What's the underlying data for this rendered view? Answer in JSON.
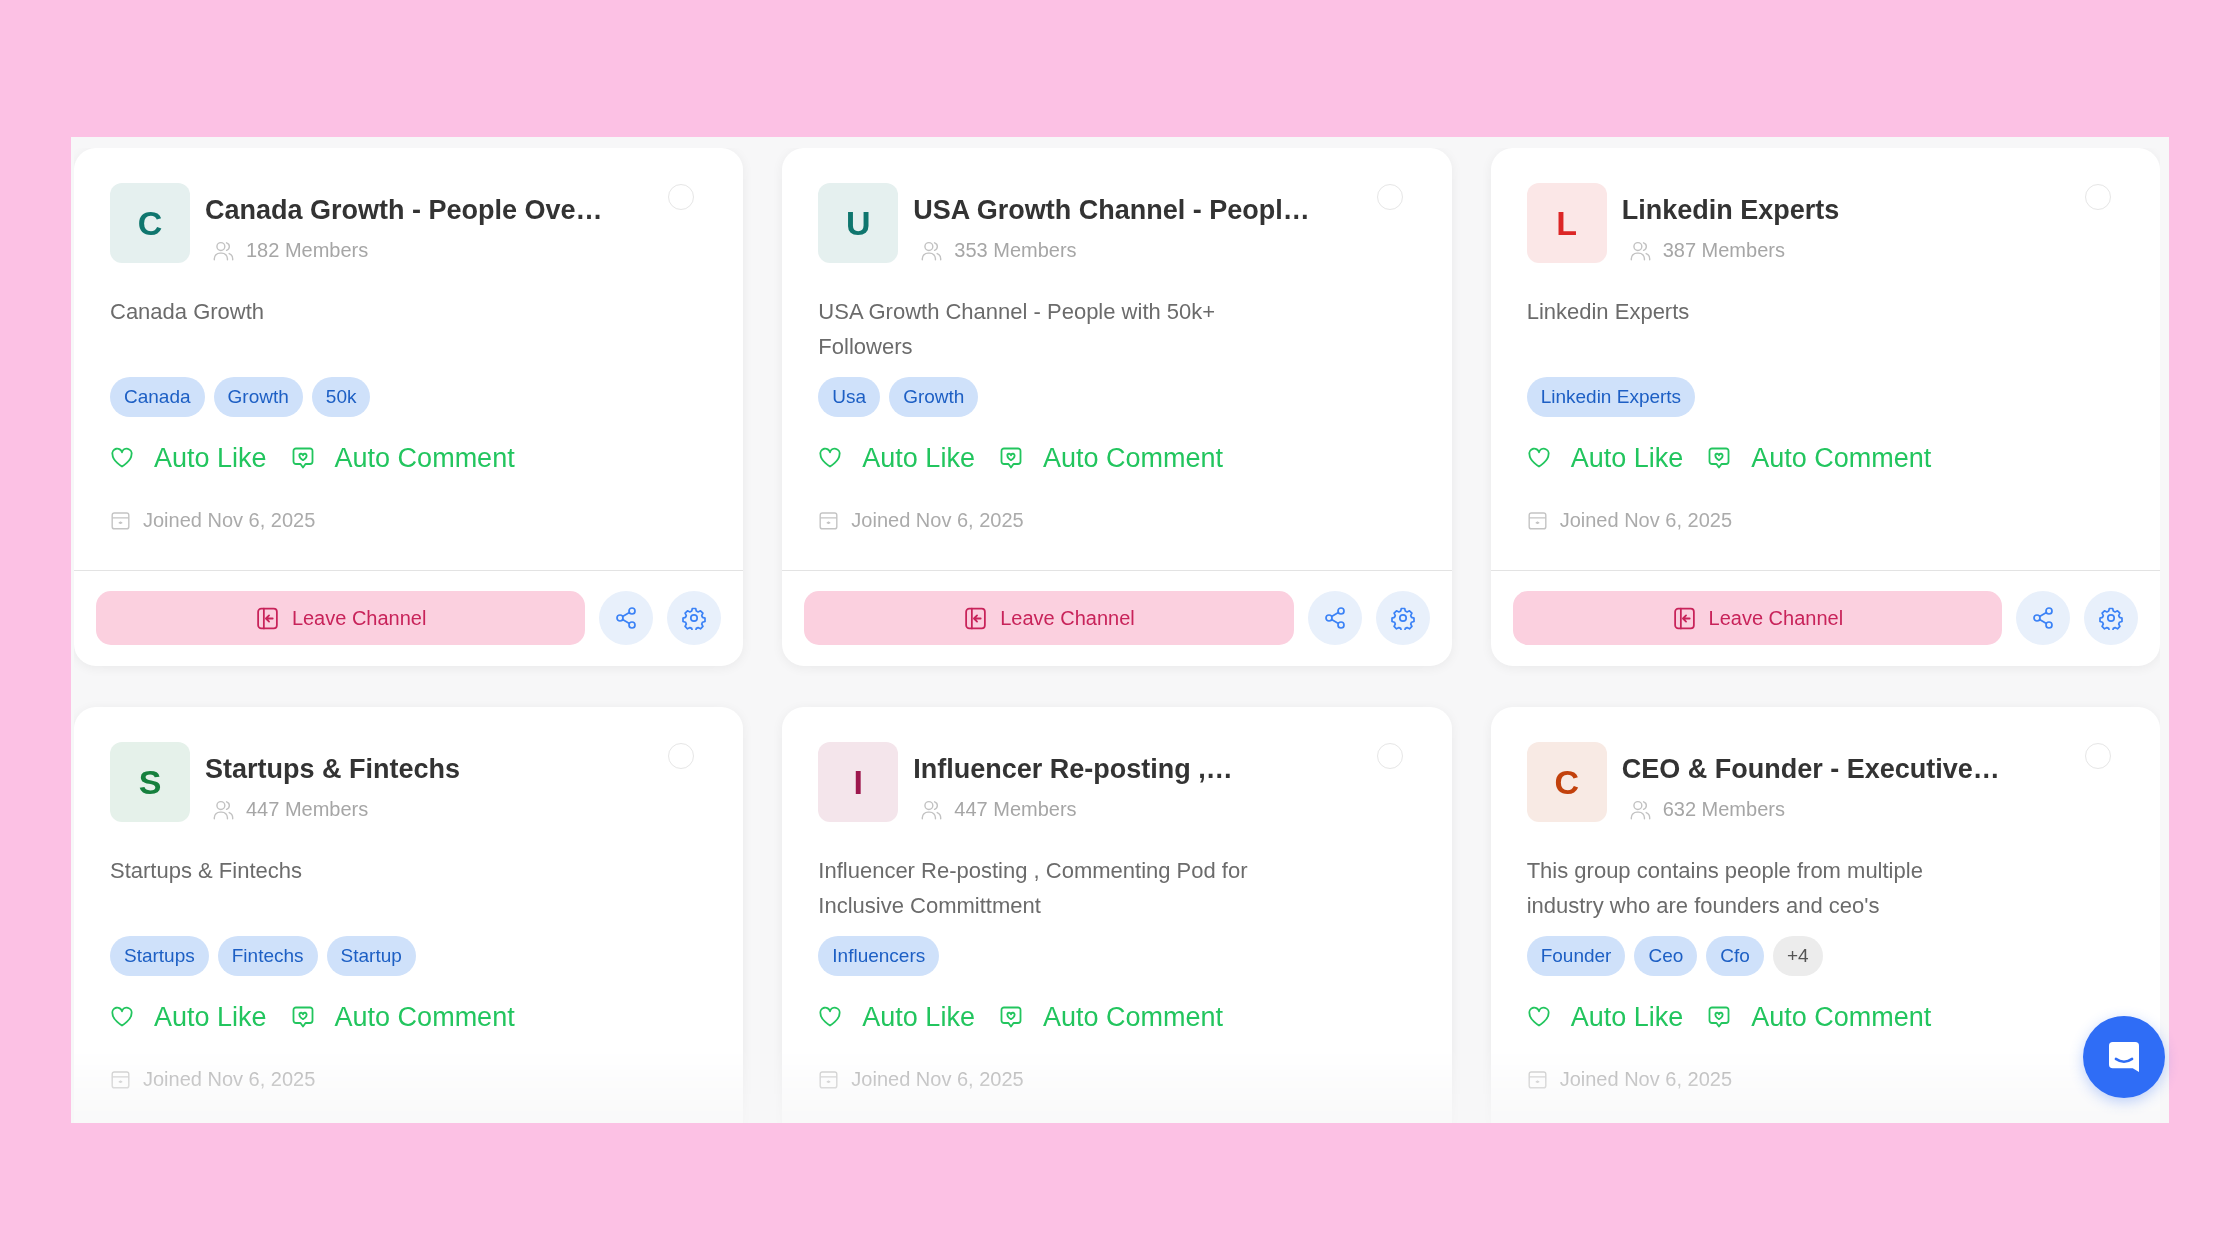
{
  "cards": [
    {
      "initial": "C",
      "color": "#0f766e",
      "title": "Canada Growth - People Ove…",
      "members": "182 Members",
      "checked": false,
      "description": "Canada Growth",
      "tags": [
        "Canada",
        "Growth",
        "50k"
      ],
      "features": [
        {
          "kind": "like",
          "label": "Auto Like",
          "on": true
        },
        {
          "kind": "comment",
          "label": "Auto Comment",
          "on": true
        }
      ],
      "joined": "Joined Nov 6, 2025",
      "leave_label": "Leave Channel"
    },
    {
      "initial": "U",
      "color": "#0f766e",
      "title": "USA Growth Channel - Peopl…",
      "members": "353 Members",
      "checked": false,
      "description": "USA Growth Channel - People with 50k+ Followers",
      "tags": [
        "Usa",
        "Growth"
      ],
      "features": [
        {
          "kind": "like",
          "label": "Auto Like",
          "on": true
        },
        {
          "kind": "comment",
          "label": "Auto Comment",
          "on": true
        }
      ],
      "joined": "Joined Nov 6, 2025",
      "leave_label": "Leave Channel"
    },
    {
      "initial": "L",
      "color": "#dc2626",
      "title": "Linkedin Experts",
      "members": "387 Members",
      "checked": false,
      "description": "Linkedin Experts",
      "tags": [
        "Linkedin Experts"
      ],
      "features": [
        {
          "kind": "like",
          "label": "Auto Like",
          "on": true
        },
        {
          "kind": "comment",
          "label": "Auto Comment",
          "on": true
        }
      ],
      "joined": "Joined Nov 6, 2025",
      "leave_label": "Leave Channel"
    },
    {
      "initial": "S",
      "color": "#15803d",
      "title": "Startups & Fintechs",
      "members": "447 Members",
      "checked": false,
      "description": "Startups & Fintechs",
      "tags": [
        "Startups",
        "Fintechs",
        "Startup"
      ],
      "features": [
        {
          "kind": "like",
          "label": "Auto Like",
          "on": true
        },
        {
          "kind": "comment",
          "label": "Auto Comment",
          "on": true
        }
      ],
      "joined": "Joined Nov 6, 2025"
    },
    {
      "initial": "I",
      "color": "#9d174d",
      "title": "Influencer Re-posting ,…",
      "members": "447 Members",
      "checked": false,
      "description": "Influencer Re-posting , Commenting Pod for Inclusive Committment",
      "tags": [
        "Influencers"
      ],
      "features": [
        {
          "kind": "like",
          "label": "Auto Like",
          "on": true
        },
        {
          "kind": "comment",
          "label": "Auto Comment",
          "on": true
        }
      ],
      "joined": "Joined Nov 6, 2025"
    },
    {
      "initial": "C",
      "color": "#c2410c",
      "title": "CEO & Founder - Executive…",
      "members": "632 Members",
      "checked": false,
      "description": "This group contains people from multiple industry who are founders and ceo's",
      "tags": [
        "Founder",
        "Ceo",
        "Cfo"
      ],
      "more_tags": "+4",
      "features": [
        {
          "kind": "like",
          "label": "Auto Like",
          "on": true
        },
        {
          "kind": "comment",
          "label": "Auto Comment",
          "on": true
        }
      ],
      "joined": "Joined Nov 6, 2025"
    }
  ]
}
